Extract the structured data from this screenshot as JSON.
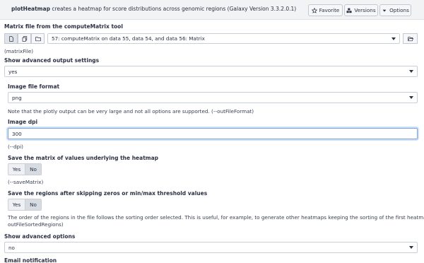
{
  "header": {
    "tool_name": "plotHeatmap",
    "tool_desc": "creates a heatmap for score distributions across genomic regions (Galaxy Version 3.3.2.0.1)",
    "favorite_label": "Favorite",
    "versions_label": "Versions",
    "options_label": "Options"
  },
  "matrix": {
    "label": "Matrix file from the computeMatrix tool",
    "value": "57: computeMatrix on data 55, data 54, and data 56: Matrix",
    "help": "(matrixFile)"
  },
  "advanced_output": {
    "label": "Show advanced output settings",
    "value": "yes"
  },
  "image_format": {
    "label": "Image file format",
    "value": "png",
    "help": "Note that the plotly output can be very large and not all options are supported. (--outFileFormat)"
  },
  "dpi": {
    "label": "Image dpi",
    "value": "300",
    "help": "(--dpi)"
  },
  "save_matrix": {
    "label": "Save the matrix of values underlying the heatmap",
    "yes": "Yes",
    "no": "No",
    "selected": "No",
    "help": "(--saveMatrix)"
  },
  "save_regions": {
    "label": "Save the regions after skipping zeros or min/max threshold values",
    "yes": "Yes",
    "no": "No",
    "selected": "No",
    "help_line1": "The order of the regions in the file follows the sorting order selected. This is useful, for example, to generate other heatmaps keeping the sorting of the first heatmap. (--",
    "help_line2": "outFileSortedRegions)"
  },
  "advanced_options": {
    "label": "Show advanced options",
    "value": "no"
  },
  "email": {
    "label": "Email notification"
  }
}
